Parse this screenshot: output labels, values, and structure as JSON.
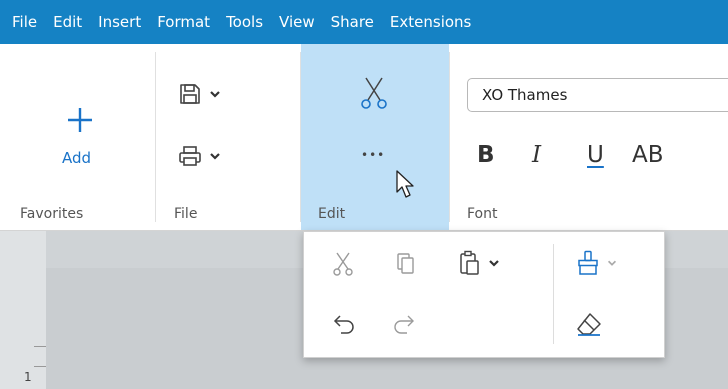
{
  "menu": [
    "File",
    "Edit",
    "Insert",
    "Format",
    "Tools",
    "View",
    "Share",
    "Extensions"
  ],
  "groups": {
    "favorites": {
      "label": "Favorites",
      "add_label": "Add"
    },
    "file": {
      "label": "File"
    },
    "edit": {
      "label": "Edit"
    },
    "font": {
      "label": "Font",
      "font_name": "XO Thames"
    }
  },
  "format_buttons": {
    "bold": "B",
    "italic": "I",
    "underline": "U",
    "caps": "AB"
  },
  "more_label": "•••",
  "ruler_number": "1",
  "icons": [
    "plus-icon",
    "save-icon",
    "print-icon",
    "cut-icon",
    "more-icon",
    "copy-icon",
    "paste-icon",
    "format-painter-icon",
    "undo-icon",
    "redo-icon",
    "eraser-icon",
    "chevron-down-icon",
    "cursor-icon"
  ],
  "colors": {
    "menubar": "#1582c4",
    "accent": "#1a73c8",
    "edit_group_highlight": "#bfe0f7",
    "disabled": "#9a9a9a"
  }
}
